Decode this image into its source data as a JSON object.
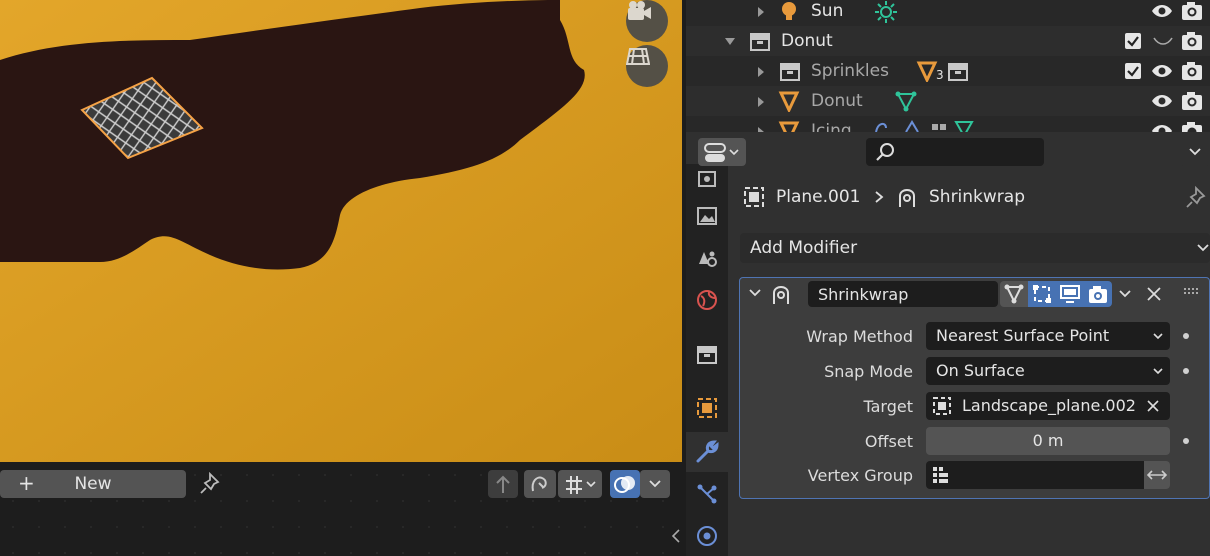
{
  "viewport": {
    "colors": {
      "ground": "#d99c1e",
      "shadow": "#2a1512",
      "selection": "#f5a246"
    }
  },
  "node_header": {
    "new_label": "New",
    "plus": "+"
  },
  "outliner": {
    "rows": [
      {
        "label": "Sun",
        "icon": "light-icon",
        "extra": "sun-data-icon"
      },
      {
        "label": "Donut",
        "icon": "collection-icon",
        "expanded": true
      },
      {
        "label": "Sprinkles",
        "icon": "collection-icon",
        "extra": "mesh-icon",
        "badge": "3"
      },
      {
        "label": "Donut",
        "icon": "mesh-object-icon",
        "extra": "mesh-data-icon"
      },
      {
        "label": "Icing",
        "icon": "mesh-object-icon"
      }
    ]
  },
  "properties": {
    "search_placeholder": "",
    "breadcrumb": {
      "object": "Plane.001",
      "modifier": "Shrinkwrap"
    },
    "add_modifier": "Add Modifier",
    "modifier": {
      "name": "Shrinkwrap",
      "fields": {
        "wrap_method_label": "Wrap Method",
        "wrap_method_value": "Nearest Surface Point",
        "snap_mode_label": "Snap Mode",
        "snap_mode_value": "On Surface",
        "target_label": "Target",
        "target_value": "Landscape_plane.002",
        "offset_label": "Offset",
        "offset_value": "0 m",
        "vertex_group_label": "Vertex Group",
        "vertex_group_value": ""
      }
    }
  }
}
